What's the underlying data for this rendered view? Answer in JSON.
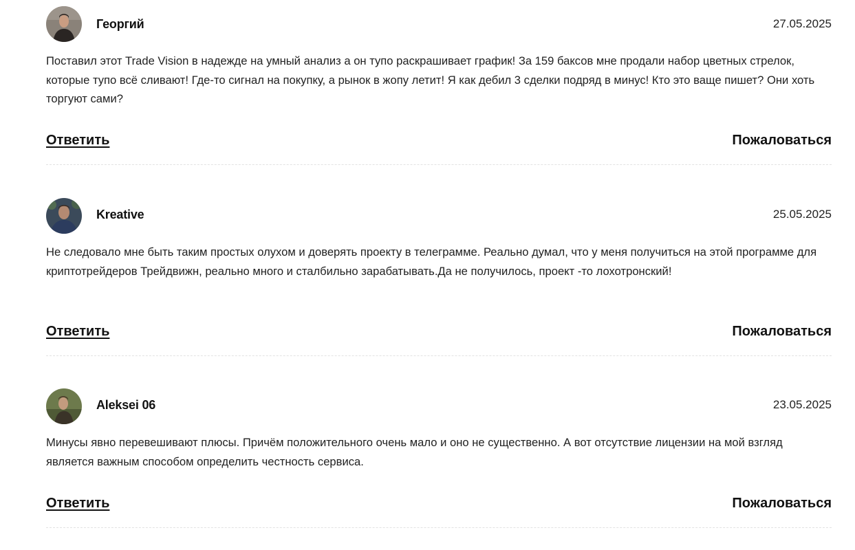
{
  "comments": [
    {
      "author": "Георгий",
      "date": "27.05.2025",
      "text": "Поставил этот Trade Vision в надежде на умный анализ а он тупо раскрашивает график! За 159 баксов мне продали набор цветных стрелок, которые тупо всё сливают! Где-то сигнал на покупку, а рынок в жопу летит! Я как дебил 3 сделки подряд в минус! Кто это ваще пишет? Они хоть торгуют сами?",
      "reply_label": "Ответить",
      "report_label": "Пожаловаться",
      "avatar_icon": "user-avatar-photo",
      "avatar_colors": {
        "bg": "#8a8279",
        "shirt": "#2a2523",
        "face": "#c99d82"
      }
    },
    {
      "author": "Kreative",
      "date": "25.05.2025",
      "text": "Не следовало мне быть таким простых олухом и доверять проекту в телеграмме. Реально думал, что у меня получиться на этой программе для криптотрейдеров Трейдвижн, реально много и сталбильно зарабатывать.Да не получилось, проект -то лохотронский!",
      "reply_label": "Ответить",
      "report_label": "Пожаловаться",
      "avatar_icon": "user-avatar-photo",
      "avatar_colors": {
        "bg": "#3b4a5a",
        "shirt": "#2c3c5e",
        "face": "#b48a72"
      }
    },
    {
      "author": "Aleksei 06",
      "date": "23.05.2025",
      "text": "Минусы явно перевешивают плюсы. Причём положительного очень мало и оно не существенно. А вот отсутствие лицензии на мой взгляд является важным способом определить честность сервиса.",
      "reply_label": "Ответить",
      "report_label": "Пожаловаться",
      "avatar_icon": "user-avatar-photo",
      "avatar_colors": {
        "bg": "#6d7a4c",
        "shirt": "#3a3328",
        "face": "#c39b7e"
      }
    }
  ]
}
